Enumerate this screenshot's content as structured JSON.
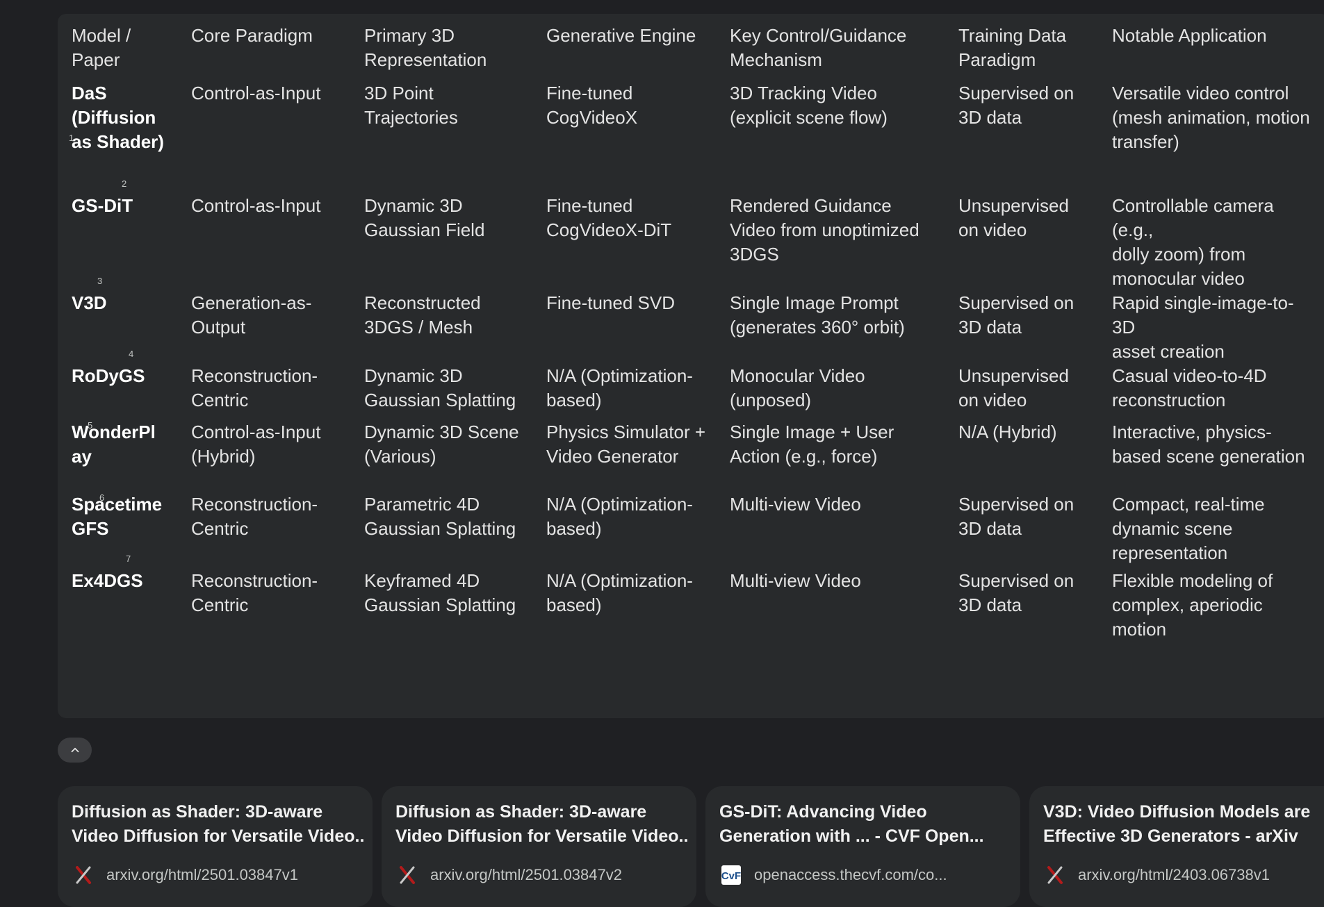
{
  "table": {
    "headers": [
      [
        "Model /",
        "Paper"
      ],
      [
        "Core Paradigm"
      ],
      [
        "Primary 3D",
        "Representation"
      ],
      [
        "Generative Engine"
      ],
      [
        "Key Control/Guidance",
        "Mechanism"
      ],
      [
        "Training Data",
        "Paradigm"
      ],
      [
        "Notable Application"
      ]
    ],
    "rows": [
      {
        "ref": "1",
        "cells": [
          [
            "DaS",
            "(Diffusion",
            "as Shader)"
          ],
          [
            "Control-as-Input"
          ],
          [
            "3D Point",
            "Trajectories"
          ],
          [
            "Fine-tuned",
            "CogVideoX"
          ],
          [
            "3D Tracking Video",
            "(explicit scene flow)"
          ],
          [
            "Supervised on",
            "3D data"
          ],
          [
            "Versatile video control",
            "(mesh animation, motion",
            "transfer)"
          ]
        ]
      },
      {
        "ref": "2",
        "cells": [
          [
            "GS-DiT"
          ],
          [
            "Control-as-Input"
          ],
          [
            "Dynamic 3D",
            "Gaussian Field"
          ],
          [
            "Fine-tuned",
            "CogVideoX-DiT"
          ],
          [
            "Rendered Guidance",
            "Video from unoptimized",
            "3DGS"
          ],
          [
            "Unsupervised",
            "on video"
          ],
          [
            "Controllable camera (e.g.,",
            "dolly zoom) from",
            "monocular video"
          ]
        ]
      },
      {
        "ref": "3",
        "cells": [
          [
            "V3D"
          ],
          [
            "Generation-as-",
            "Output"
          ],
          [
            "Reconstructed",
            "3DGS / Mesh"
          ],
          [
            "Fine-tuned SVD"
          ],
          [
            "Single Image Prompt",
            "(generates 360° orbit)"
          ],
          [
            "Supervised on",
            "3D data"
          ],
          [
            "Rapid single-image-to-3D",
            "asset creation"
          ]
        ]
      },
      {
        "ref": "4",
        "cells": [
          [
            "RoDyGS"
          ],
          [
            "Reconstruction-",
            "Centric"
          ],
          [
            "Dynamic 3D",
            "Gaussian Splatting"
          ],
          [
            "N/A (Optimization-",
            "based)"
          ],
          [
            "Monocular Video",
            "(unposed)"
          ],
          [
            "Unsupervised",
            "on video"
          ],
          [
            "Casual video-to-4D",
            "reconstruction"
          ]
        ]
      },
      {
        "ref": "5",
        "cells": [
          [
            "WonderPl",
            "ay"
          ],
          [
            "Control-as-Input",
            "(Hybrid)"
          ],
          [
            "Dynamic 3D Scene",
            "(Various)"
          ],
          [
            "Physics Simulator +",
            "Video Generator"
          ],
          [
            "Single Image + User",
            "Action (e.g., force)"
          ],
          [
            "N/A (Hybrid)"
          ],
          [
            "Interactive, physics-",
            "based scene generation"
          ]
        ]
      },
      {
        "ref": "6",
        "cells": [
          [
            "Spacetime",
            "GFS"
          ],
          [
            "Reconstruction-",
            "Centric"
          ],
          [
            "Parametric 4D",
            "Gaussian Splatting"
          ],
          [
            "N/A (Optimization-",
            "based)"
          ],
          [
            "Multi-view Video"
          ],
          [
            "Supervised on",
            "3D data"
          ],
          [
            "Compact, real-time",
            "dynamic scene",
            "representation"
          ]
        ]
      },
      {
        "ref": "7",
        "cells": [
          [
            "Ex4DGS"
          ],
          [
            "Reconstruction-",
            "Centric"
          ],
          [
            "Keyframed 4D",
            "Gaussian Splatting"
          ],
          [
            "N/A (Optimization-",
            "based)"
          ],
          [
            "Multi-view Video"
          ],
          [
            "Supervised on",
            "3D data"
          ],
          [
            "Flexible modeling of",
            "complex, aperiodic",
            "motion"
          ]
        ]
      }
    ]
  },
  "collapse_icon": "chevron-up-icon",
  "sources": [
    {
      "title": [
        "Diffusion as Shader: 3D-aware",
        "Video Diffusion for Versatile Video..."
      ],
      "url": "arxiv.org/html/2501.03847v1",
      "icon": "arxiv-favicon-icon"
    },
    {
      "title": [
        "Diffusion as Shader: 3D-aware",
        "Video Diffusion for Versatile Video..."
      ],
      "url": "arxiv.org/html/2501.03847v2",
      "icon": "arxiv-favicon-icon"
    },
    {
      "title": [
        "GS-DiT: Advancing Video",
        "Generation with ... - CVF Open..."
      ],
      "url": "openaccess.thecvf.com/co...",
      "icon": "cvf-favicon-icon"
    },
    {
      "title": [
        "V3D: Video Diffusion Models are",
        "Effective 3D Generators - arXiv"
      ],
      "url": "arxiv.org/html/2403.06738v1",
      "icon": "arxiv-favicon-icon"
    }
  ],
  "colors": {
    "background": "#1f2023",
    "card": "#282a2c",
    "text": "#e3e3e3",
    "muted": "#c4c7c5",
    "arxiv_red": "#b31b1b",
    "cvf_blue": "#1c4f8c"
  }
}
